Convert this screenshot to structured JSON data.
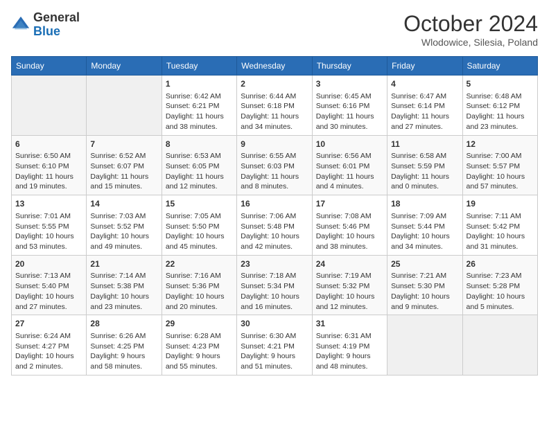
{
  "header": {
    "logo_line1": "General",
    "logo_line2": "Blue",
    "month": "October 2024",
    "location": "Wlodowice, Silesia, Poland"
  },
  "days_of_week": [
    "Sunday",
    "Monday",
    "Tuesday",
    "Wednesday",
    "Thursday",
    "Friday",
    "Saturday"
  ],
  "weeks": [
    [
      {
        "day": "",
        "empty": true
      },
      {
        "day": "",
        "empty": true
      },
      {
        "day": "1",
        "sunrise": "6:42 AM",
        "sunset": "6:21 PM",
        "daylight": "11 hours and 38 minutes."
      },
      {
        "day": "2",
        "sunrise": "6:44 AM",
        "sunset": "6:18 PM",
        "daylight": "11 hours and 34 minutes."
      },
      {
        "day": "3",
        "sunrise": "6:45 AM",
        "sunset": "6:16 PM",
        "daylight": "11 hours and 30 minutes."
      },
      {
        "day": "4",
        "sunrise": "6:47 AM",
        "sunset": "6:14 PM",
        "daylight": "11 hours and 27 minutes."
      },
      {
        "day": "5",
        "sunrise": "6:48 AM",
        "sunset": "6:12 PM",
        "daylight": "11 hours and 23 minutes."
      }
    ],
    [
      {
        "day": "6",
        "sunrise": "6:50 AM",
        "sunset": "6:10 PM",
        "daylight": "11 hours and 19 minutes."
      },
      {
        "day": "7",
        "sunrise": "6:52 AM",
        "sunset": "6:07 PM",
        "daylight": "11 hours and 15 minutes."
      },
      {
        "day": "8",
        "sunrise": "6:53 AM",
        "sunset": "6:05 PM",
        "daylight": "11 hours and 12 minutes."
      },
      {
        "day": "9",
        "sunrise": "6:55 AM",
        "sunset": "6:03 PM",
        "daylight": "11 hours and 8 minutes."
      },
      {
        "day": "10",
        "sunrise": "6:56 AM",
        "sunset": "6:01 PM",
        "daylight": "11 hours and 4 minutes."
      },
      {
        "day": "11",
        "sunrise": "6:58 AM",
        "sunset": "5:59 PM",
        "daylight": "11 hours and 0 minutes."
      },
      {
        "day": "12",
        "sunrise": "7:00 AM",
        "sunset": "5:57 PM",
        "daylight": "10 hours and 57 minutes."
      }
    ],
    [
      {
        "day": "13",
        "sunrise": "7:01 AM",
        "sunset": "5:55 PM",
        "daylight": "10 hours and 53 minutes."
      },
      {
        "day": "14",
        "sunrise": "7:03 AM",
        "sunset": "5:52 PM",
        "daylight": "10 hours and 49 minutes."
      },
      {
        "day": "15",
        "sunrise": "7:05 AM",
        "sunset": "5:50 PM",
        "daylight": "10 hours and 45 minutes."
      },
      {
        "day": "16",
        "sunrise": "7:06 AM",
        "sunset": "5:48 PM",
        "daylight": "10 hours and 42 minutes."
      },
      {
        "day": "17",
        "sunrise": "7:08 AM",
        "sunset": "5:46 PM",
        "daylight": "10 hours and 38 minutes."
      },
      {
        "day": "18",
        "sunrise": "7:09 AM",
        "sunset": "5:44 PM",
        "daylight": "10 hours and 34 minutes."
      },
      {
        "day": "19",
        "sunrise": "7:11 AM",
        "sunset": "5:42 PM",
        "daylight": "10 hours and 31 minutes."
      }
    ],
    [
      {
        "day": "20",
        "sunrise": "7:13 AM",
        "sunset": "5:40 PM",
        "daylight": "10 hours and 27 minutes."
      },
      {
        "day": "21",
        "sunrise": "7:14 AM",
        "sunset": "5:38 PM",
        "daylight": "10 hours and 23 minutes."
      },
      {
        "day": "22",
        "sunrise": "7:16 AM",
        "sunset": "5:36 PM",
        "daylight": "10 hours and 20 minutes."
      },
      {
        "day": "23",
        "sunrise": "7:18 AM",
        "sunset": "5:34 PM",
        "daylight": "10 hours and 16 minutes."
      },
      {
        "day": "24",
        "sunrise": "7:19 AM",
        "sunset": "5:32 PM",
        "daylight": "10 hours and 12 minutes."
      },
      {
        "day": "25",
        "sunrise": "7:21 AM",
        "sunset": "5:30 PM",
        "daylight": "10 hours and 9 minutes."
      },
      {
        "day": "26",
        "sunrise": "7:23 AM",
        "sunset": "5:28 PM",
        "daylight": "10 hours and 5 minutes."
      }
    ],
    [
      {
        "day": "27",
        "sunrise": "6:24 AM",
        "sunset": "4:27 PM",
        "daylight": "10 hours and 2 minutes."
      },
      {
        "day": "28",
        "sunrise": "6:26 AM",
        "sunset": "4:25 PM",
        "daylight": "9 hours and 58 minutes."
      },
      {
        "day": "29",
        "sunrise": "6:28 AM",
        "sunset": "4:23 PM",
        "daylight": "9 hours and 55 minutes."
      },
      {
        "day": "30",
        "sunrise": "6:30 AM",
        "sunset": "4:21 PM",
        "daylight": "9 hours and 51 minutes."
      },
      {
        "day": "31",
        "sunrise": "6:31 AM",
        "sunset": "4:19 PM",
        "daylight": "9 hours and 48 minutes."
      },
      {
        "day": "",
        "empty": true
      },
      {
        "day": "",
        "empty": true
      }
    ]
  ],
  "labels": {
    "sunrise_prefix": "Sunrise: ",
    "sunset_prefix": "Sunset: ",
    "daylight_prefix": "Daylight: "
  }
}
